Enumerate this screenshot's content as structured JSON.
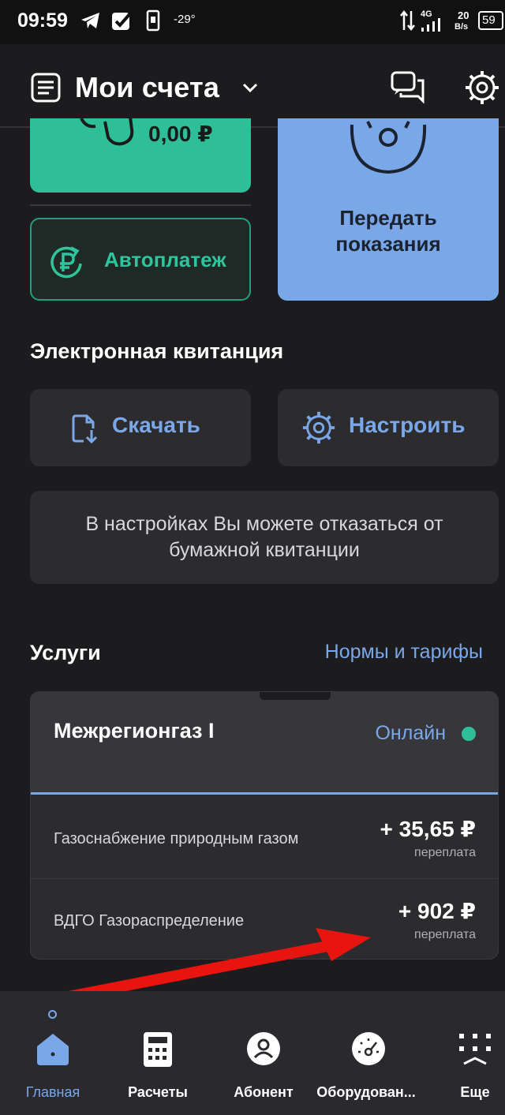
{
  "status_bar": {
    "time": "09:59",
    "temperature": "-29°",
    "network": "4G",
    "speed_value": "20",
    "speed_unit": "B/s",
    "battery": "59",
    "icons": [
      "telegram-icon",
      "checkbox-app-icon",
      "phone-icon",
      "data-transfer-icon",
      "signal-icon",
      "battery-icon"
    ]
  },
  "header": {
    "title": "Мои счета",
    "icons": [
      "accounts-list-icon",
      "chevron-down-icon",
      "chat-icon",
      "settings-gear-icon"
    ]
  },
  "balance_card": {
    "amount": "0,00 ₽",
    "color": "#2ebf98"
  },
  "autopay": {
    "label": "Автоплатеж",
    "icon": "ruble-cycle-icon"
  },
  "meter_card": {
    "label_line1": "Передать",
    "label_line2": "показания",
    "icon": "meter-face-icon",
    "color": "#7aa7e8"
  },
  "receipt": {
    "title": "Электронная квитанция",
    "download_label": "Скачать",
    "settings_label": "Настроить",
    "info_line1": "В настройках Вы можете отказаться от",
    "info_line2": "бумажной квитанции"
  },
  "services": {
    "title": "Услуги",
    "link": "Нормы и тарифы",
    "provider": "Межрегионгаз I",
    "status": "Онлайн",
    "status_color": "#2ebf98",
    "rows": [
      {
        "name": "Газоснабжение природным газом",
        "amount": "+ 35,65 ₽",
        "note": "переплата"
      },
      {
        "name": "ВДГО Газораспределение",
        "amount": "+ 902 ₽",
        "note": "переплата"
      }
    ]
  },
  "bottom_nav": {
    "items": [
      {
        "label": "Главная",
        "icon": "home-icon",
        "active": true
      },
      {
        "label": "Расчеты",
        "icon": "calculator-icon",
        "active": false
      },
      {
        "label": "Абонент",
        "icon": "user-icon",
        "active": false
      },
      {
        "label": "Оборудован...",
        "icon": "gauge-icon",
        "active": false
      },
      {
        "label": "Еще",
        "icon": "more-grid-icon",
        "active": false
      }
    ]
  },
  "annotation": {
    "color": "#e8140f"
  }
}
